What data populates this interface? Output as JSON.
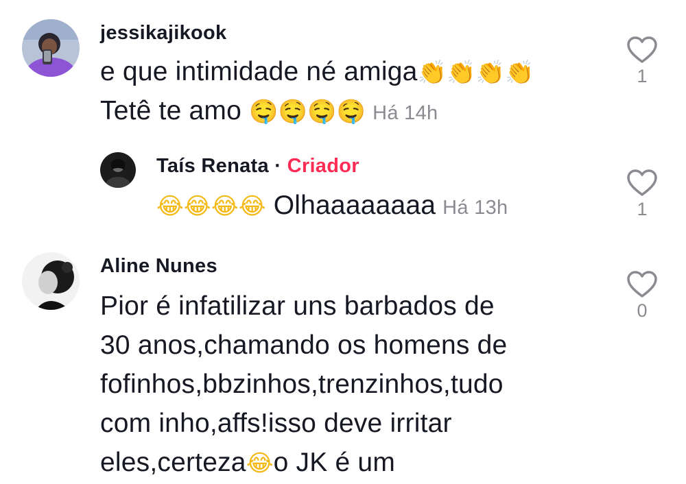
{
  "comments": [
    {
      "username": "jessikajikook",
      "text_line1": "e que intimidade né amiga",
      "emojis_line1": "👏👏👏👏",
      "text_line2": "Tetê te amo ",
      "emojis_line2": "🤤🤤🤤🤤",
      "time": "Há 14h",
      "likes": "1",
      "icon": "heart-outline-icon"
    },
    {
      "username": "Taís Renata",
      "separator": "·",
      "badge": "Criador",
      "emojis": "😂😂😂😂",
      "text": " Olhaaaaaaaa",
      "time": "Há 13h",
      "likes": "1",
      "icon": "heart-outline-icon"
    },
    {
      "username": "Aline Nunes",
      "lines": [
        "Pior é infatilizar uns barbados de",
        "30 anos,chamando os homens de",
        "fofinhos,bbzinhos,trenzinhos,tudo",
        "com inho,affs!isso deve irritar"
      ],
      "last_line_a": "eles,certeza",
      "last_line_emoji": "😂",
      "last_line_b": "o JK é um",
      "likes": "0",
      "icon": "heart-outline-icon"
    }
  ],
  "colors": {
    "text": "#161823",
    "muted": "#8a8b91",
    "creator": "#fe2c55"
  }
}
